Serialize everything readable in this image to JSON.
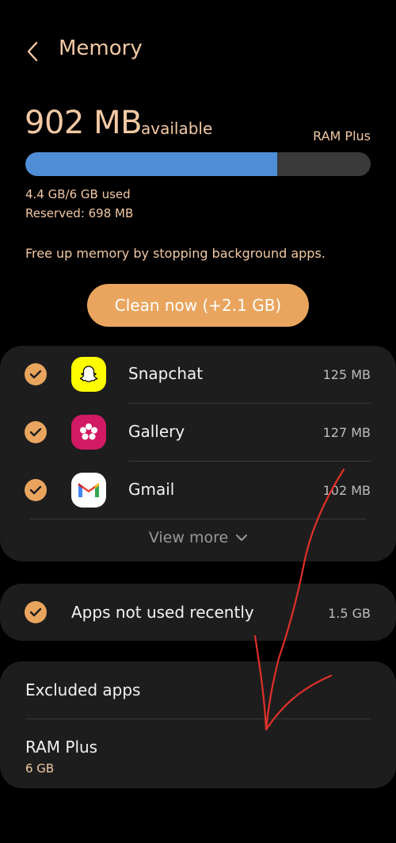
{
  "header": {
    "title": "Memory"
  },
  "memory": {
    "available_value": "902 MB",
    "available_label": "available",
    "ram_plus_label": "RAM Plus",
    "used_fraction": 0.73,
    "used_text": "4.4 GB/6 GB used",
    "reserved_text": "Reserved: 698 MB",
    "hint": "Free up memory by stopping background apps."
  },
  "clean_button": {
    "label": "Clean now (+2.1 GB)"
  },
  "apps": [
    {
      "name": "Snapchat",
      "size": "125 MB",
      "icon": "snapchat-icon"
    },
    {
      "name": "Gallery",
      "size": "127 MB",
      "icon": "gallery-icon"
    },
    {
      "name": "Gmail",
      "size": "102 MB",
      "icon": "gmail-icon"
    }
  ],
  "view_more": {
    "label": "View more"
  },
  "not_used": {
    "label": "Apps not used recently",
    "size": "1.5 GB"
  },
  "excluded": {
    "label": "Excluded apps"
  },
  "ram_plus": {
    "label": "RAM Plus",
    "value": "6 GB"
  },
  "colors": {
    "accent": "#e9a55e",
    "title": "#f3c9a4",
    "bar_fill": "#4f8ed6",
    "annotation": "#e0302a"
  }
}
